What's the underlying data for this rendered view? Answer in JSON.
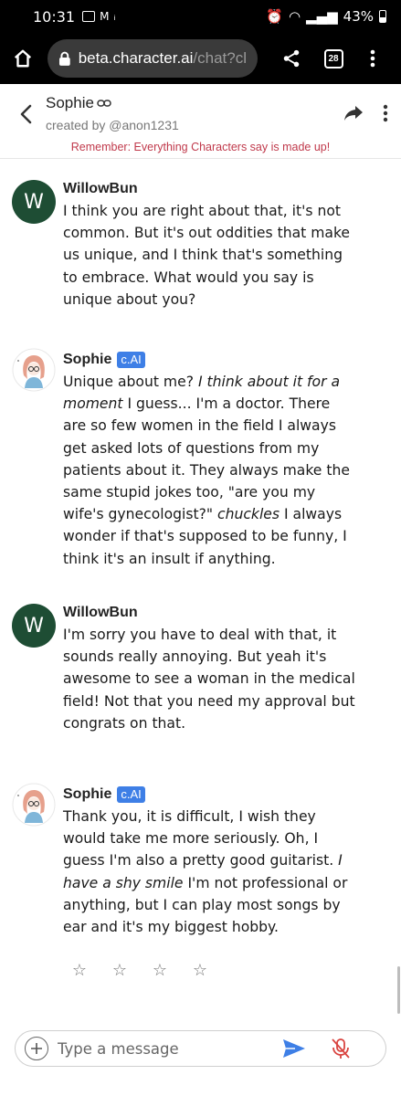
{
  "status_bar": {
    "time": "10:31",
    "battery": "43%"
  },
  "browser": {
    "url_host": "beta.character.ai",
    "url_path": "/chat?cl",
    "tab_count": "28"
  },
  "header": {
    "character_name": "Sophie",
    "creator": "created by @anon1231",
    "disclaimer": "Remember: Everything Characters say is made up!"
  },
  "messages": [
    {
      "author": "WillowBun",
      "avatar_letter": "W",
      "badge": "",
      "text": "I think you are right about that, it's not common. But it's out oddities that make us unique, and I think that's something to embrace. What would you say is unique about you?"
    },
    {
      "author": "Sophie",
      "badge": "c.AI",
      "parts": [
        "Unique about me? ",
        "I think about it for a moment",
        " I guess... I'm a doctor. There are so few women in the field I always get asked lots of questions from my patients about it. They always make the same stupid jokes too, \"are you my wife's gynecologist?\" ",
        "chuckles",
        " I always wonder if that's supposed to be funny, I think it's an insult if anything."
      ]
    },
    {
      "author": "WillowBun",
      "avatar_letter": "W",
      "badge": "",
      "text": "I'm sorry you have to deal with that, it sounds really annoying. But yeah it's awesome to see a woman in the medical field! Not that you need my approval but congrats on that."
    },
    {
      "author": "Sophie",
      "badge": "c.AI",
      "parts": [
        "Thank you, it is difficult, I wish they would take me more seriously. Oh, I guess I'm also a pretty good guitarist. ",
        "I have a shy smile",
        " I'm not professional or anything, but I can play most songs by ear and it's my biggest hobby."
      ]
    }
  ],
  "rating_stars": [
    "☆",
    "☆",
    "☆",
    "☆"
  ],
  "input": {
    "placeholder": "Type a message"
  },
  "colors": {
    "accent": "#3e7fe6",
    "user_avatar": "#1e4d34",
    "disclaimer": "#c0394b"
  }
}
